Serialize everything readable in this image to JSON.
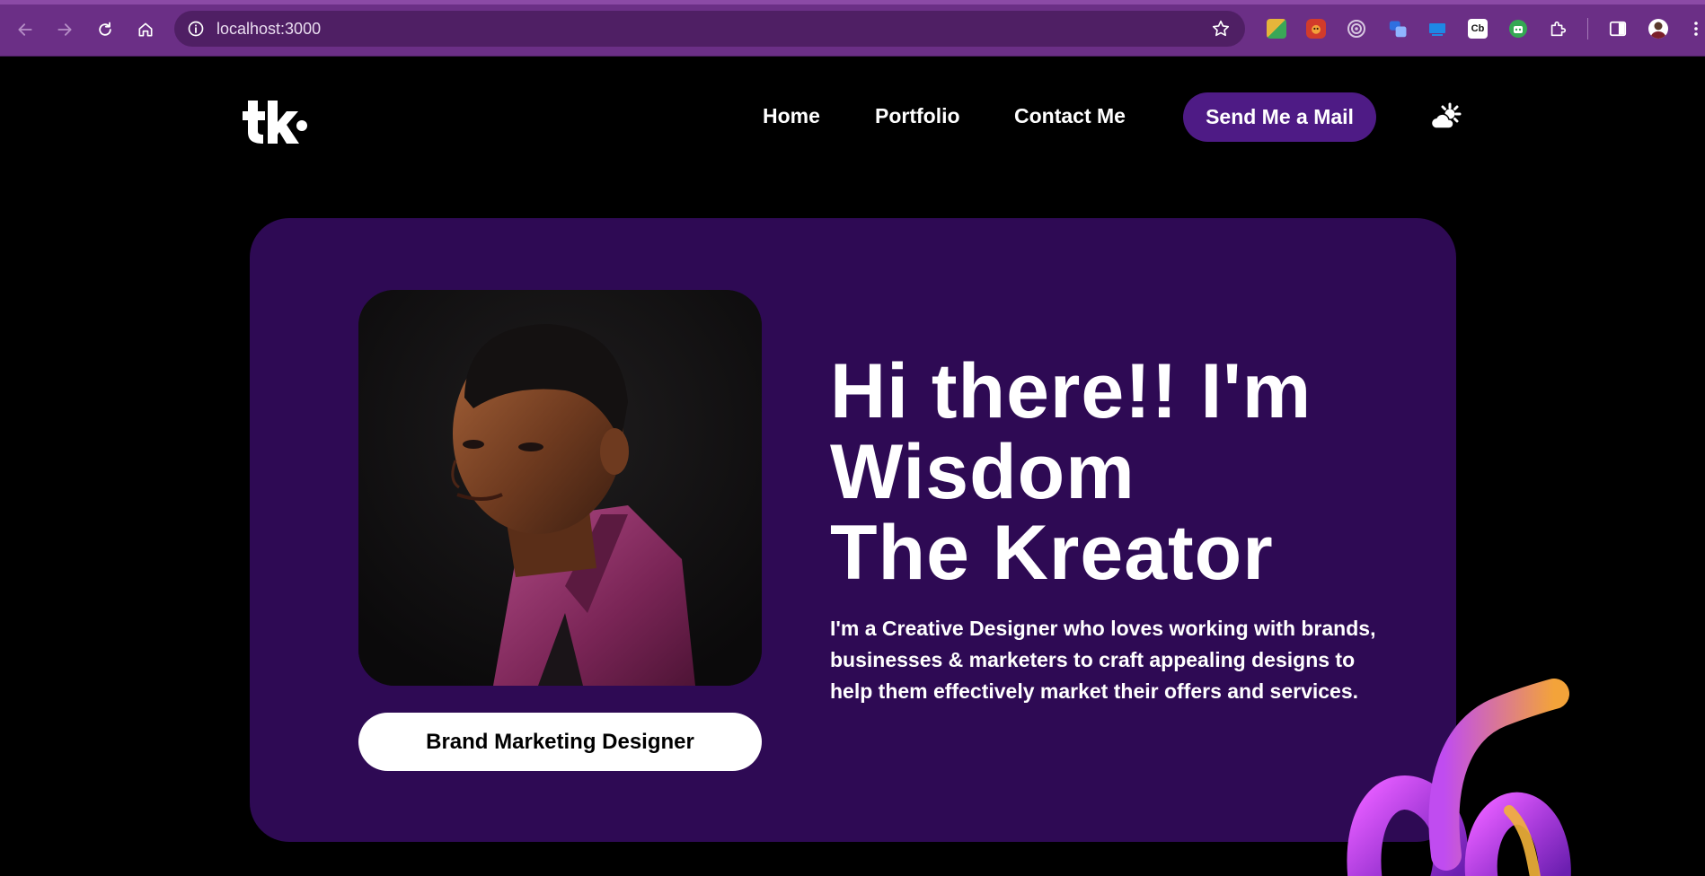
{
  "browser": {
    "url": "localhost:3000",
    "extensions": [
      {
        "name": "puzzle-color-extension",
        "color": "#d9a33b"
      },
      {
        "name": "red-bug-extension",
        "color": "#d23b2b"
      },
      {
        "name": "target-extension",
        "color": "#b9a3c6"
      },
      {
        "name": "blue-pen-extension",
        "color": "#2f6fe0"
      },
      {
        "name": "screen-extension",
        "color": "#1e88e5"
      },
      {
        "name": "cb-extension",
        "label": "Cb",
        "color": "#1f1f1f"
      },
      {
        "name": "green-robot-extension",
        "color": "#34a853"
      },
      {
        "name": "extensions-puzzle",
        "color": "#ffffff"
      }
    ]
  },
  "nav": {
    "logo_text": "tk.",
    "links": [
      "Home",
      "Portfolio",
      "Contact Me"
    ],
    "cta": "Send Me a Mail"
  },
  "hero": {
    "headline": [
      "Hi there!! I'm",
      "Wisdom",
      "The Kreator"
    ],
    "bio": "I'm a Creative Designer who loves working with brands, businesses & marketers to craft appealing designs to help them effectively market their offers and services.",
    "role": "Brand Marketing Designer"
  },
  "colors": {
    "chrome": "#6b2f86",
    "hero_bg": "#2e0a54",
    "cta_bg": "#4e1b85",
    "page_bg": "#000000"
  }
}
